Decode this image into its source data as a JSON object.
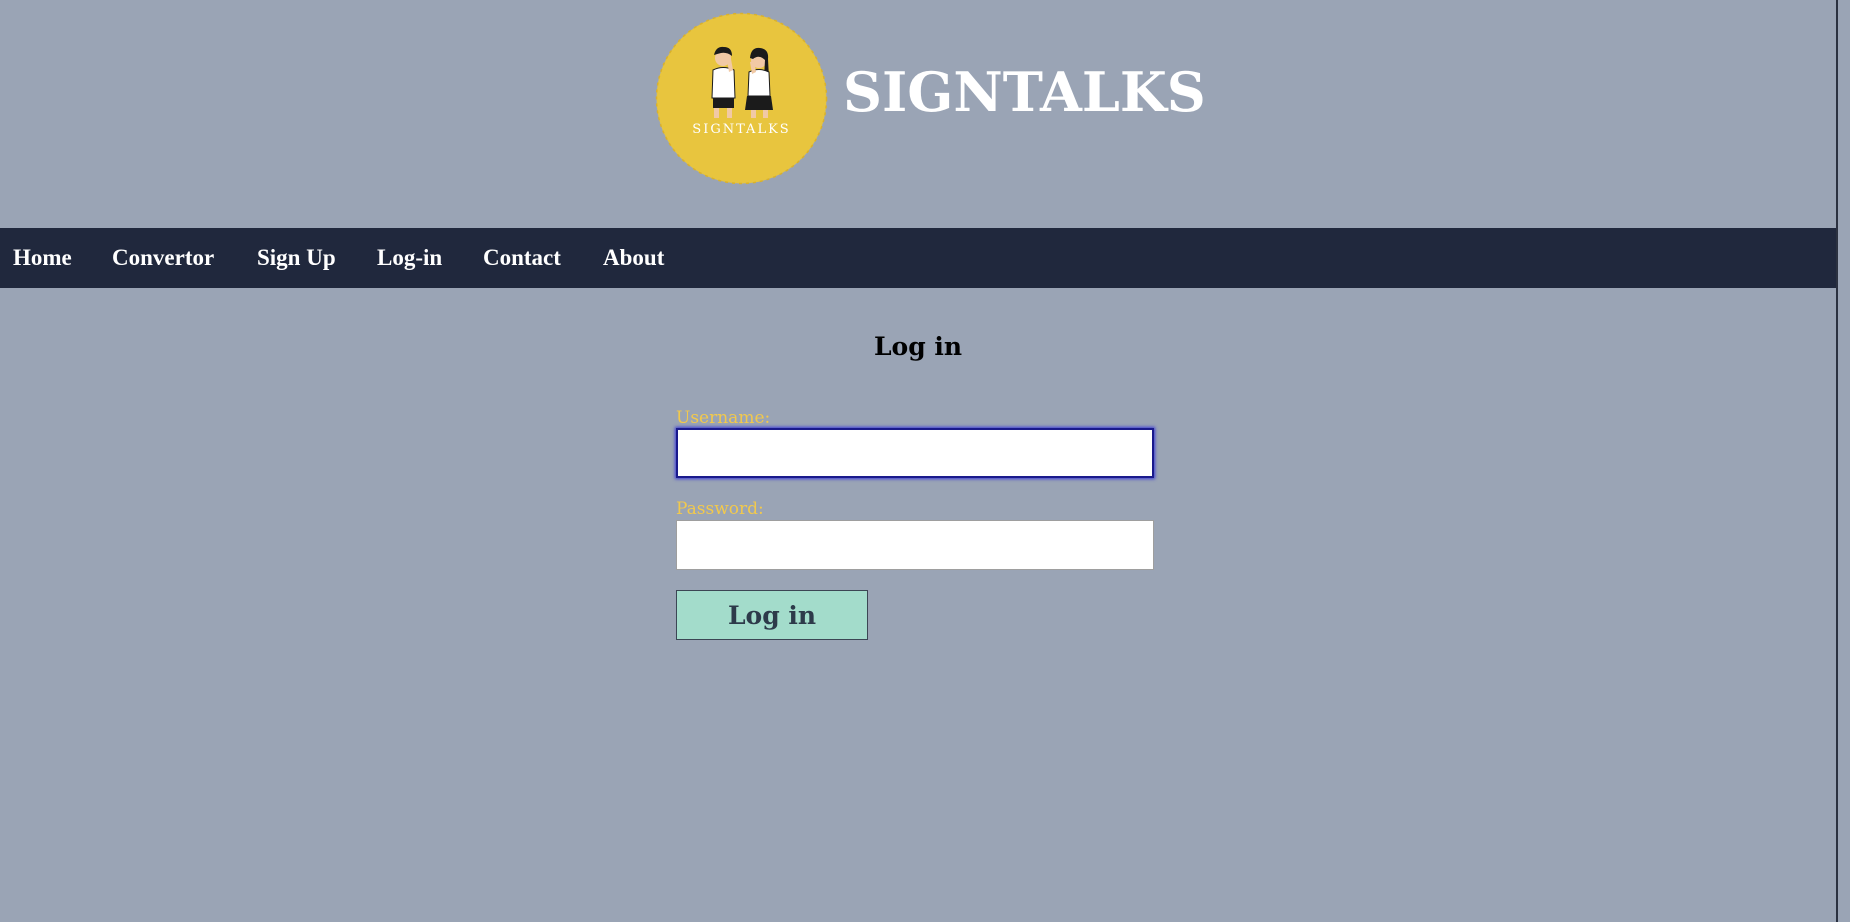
{
  "brand": {
    "logo_text": "SIGNTALKS",
    "title": "SIGNTALKS",
    "logo_icon": "two-people-signing-icon",
    "logo_color": "#e8c53e"
  },
  "nav": {
    "items": [
      {
        "label": "Home"
      },
      {
        "label": "Convertor"
      },
      {
        "label": "Sign Up"
      },
      {
        "label": "Log-in"
      },
      {
        "label": "Contact"
      },
      {
        "label": "About"
      }
    ]
  },
  "login": {
    "title": "Log in",
    "username_label": "Username:",
    "username_value": "",
    "password_label": "Password:",
    "password_value": "",
    "submit_label": "Log in"
  },
  "colors": {
    "background": "#9aa4b5",
    "navbar": "#20283d",
    "label": "#f2c94c",
    "button": "#a3dccb"
  }
}
